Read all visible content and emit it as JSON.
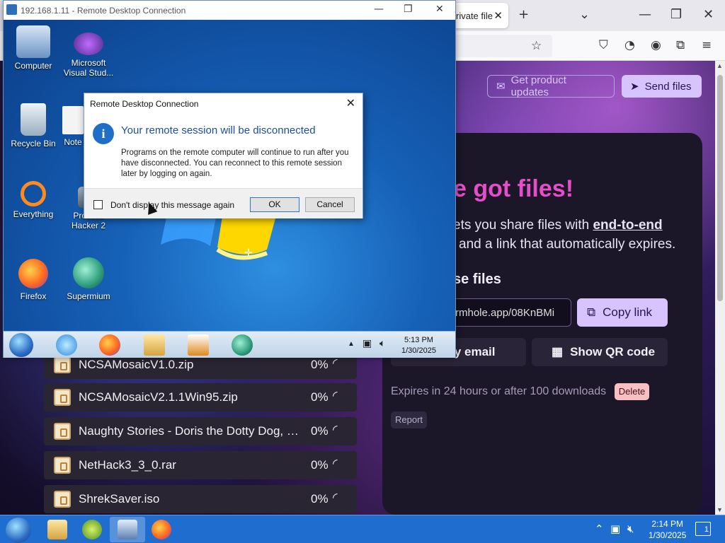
{
  "browser": {
    "tab_title": "rivate file",
    "tab_close": "✕",
    "new_tab": "+",
    "list_tabs": "⌄",
    "minimize": "—",
    "maximize": "❐",
    "close": "✕"
  },
  "page": {
    "product_updates_label": "Get product updates",
    "send_files_label": "Send files",
    "headline": "e got files!",
    "body_line1_prefix": "ets you share files with ",
    "body_line1_link": "end-to-end",
    "body_line2": "and a link that automatically expires.",
    "share_heading": "se files",
    "share_link_value": "rmhole.app/08KnBMi",
    "copy_link_label": "Copy link",
    "email_label": "l by email",
    "qr_label": "Show QR code",
    "expiry_text": "Expires in 24 hours or after 100 downloads",
    "delete_label": "Delete",
    "report_label": "Report"
  },
  "files": [
    {
      "name": "NCSAMosaicV1.0.zip",
      "percent": "0%"
    },
    {
      "name": "NCSAMosaicV2.1.1Win95.zip",
      "percent": "0%"
    },
    {
      "name": "Naughty Stories - Doris the Dotty Dog, Clar...",
      "percent": "0%"
    },
    {
      "name": "NetHack3_3_0.rar",
      "percent": "0%"
    },
    {
      "name": "ShrekSaver.iso",
      "percent": "0%"
    }
  ],
  "rdp": {
    "title": "192.168.1.11 - Remote Desktop Connection",
    "desktop_icons": {
      "computer": "Computer",
      "visual_studio_1": "Microsoft",
      "visual_studio_2": "Visual Stud...",
      "recycle_bin": "Recycle Bin",
      "notepad": "Note",
      "everything": "Everything",
      "process_hacker_1": "Process",
      "process_hacker_2": "Hacker 2",
      "firefox": "Firefox",
      "supermium": "Supermium"
    },
    "clock_time": "5:13 PM",
    "clock_date": "1/30/2025"
  },
  "dialog": {
    "title": "Remote Desktop Connection",
    "heading": "Your remote session will be disconnected",
    "message": "Programs on the remote computer will continue to run after you have disconnected. You can reconnect to this remote session later by logging on again.",
    "checkbox_label": "Don't display this message again",
    "ok_label": "OK",
    "cancel_label": "Cancel"
  },
  "host_taskbar": {
    "clock_time": "2:14 PM",
    "clock_date": "1/30/2025",
    "notification_count": "1"
  },
  "colors": {
    "accent": "#d7c4ff",
    "headline": "#e64ec9",
    "dialog_heading": "#1c4ea0",
    "host_taskbar": "#1f6ecf"
  }
}
